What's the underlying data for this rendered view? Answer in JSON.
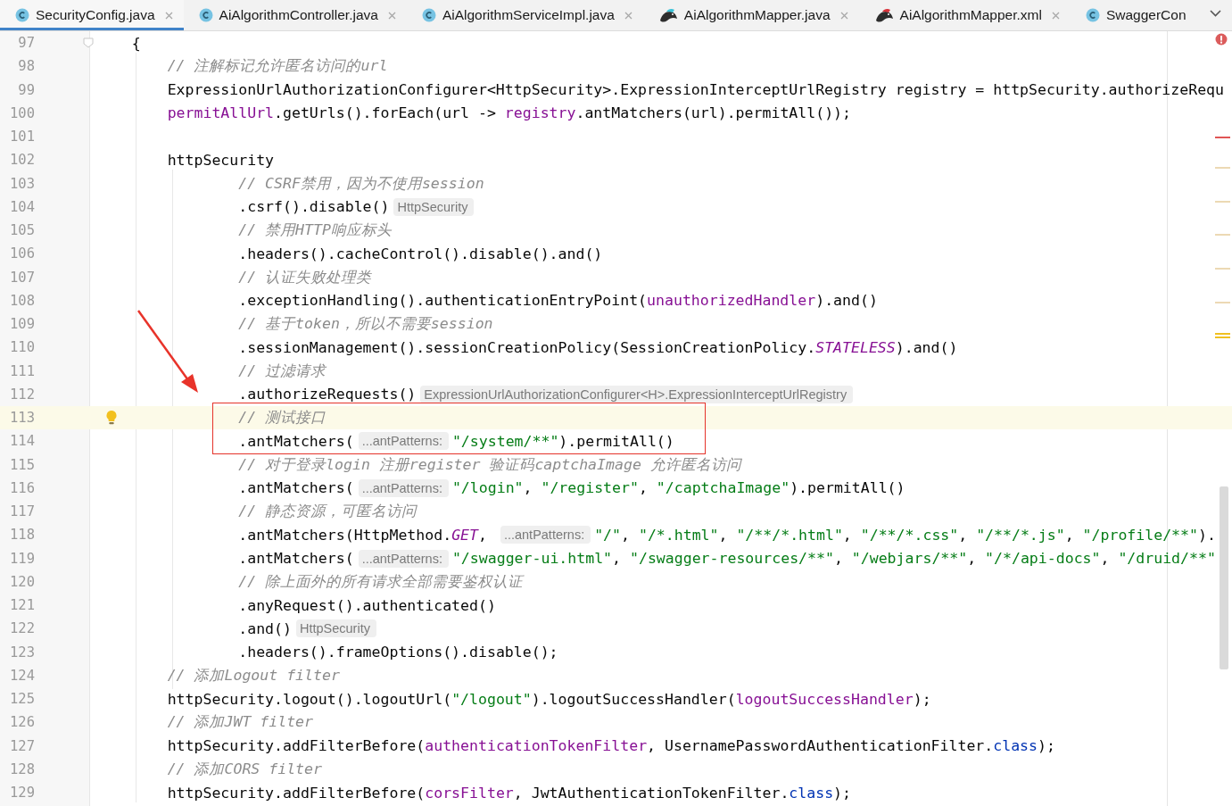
{
  "tabs": [
    {
      "label": "SecurityConfig.java",
      "kind": "class",
      "selected": true,
      "closable": true
    },
    {
      "label": "AiAlgorithmController.java",
      "kind": "class",
      "selected": false,
      "closable": true
    },
    {
      "label": "AiAlgorithmServiceImpl.java",
      "kind": "class",
      "selected": false,
      "closable": true
    },
    {
      "label": "AiAlgorithmMapper.java",
      "kind": "mapper-java",
      "selected": false,
      "closable": true
    },
    {
      "label": "AiAlgorithmMapper.xml",
      "kind": "mapper-xml",
      "selected": false,
      "closable": true
    },
    {
      "label": "SwaggerCon",
      "kind": "class",
      "selected": false,
      "closable": false
    }
  ],
  "editor": {
    "lines": [
      {
        "number": "97",
        "current": false,
        "tokens": [
          {
            "kind": "plain",
            "text": "    {"
          }
        ]
      },
      {
        "number": "98",
        "current": false,
        "tokens": [
          {
            "kind": "comment",
            "text": "        // 注解标记允许匿名访问的url"
          }
        ]
      },
      {
        "number": "99",
        "current": false,
        "tokens": [
          {
            "kind": "plain",
            "text": "        ExpressionUrlAuthorizationConfigurer<HttpSecurity>.ExpressionInterceptUrlRegistry registry = httpSecurity.authorizeRequ"
          }
        ]
      },
      {
        "number": "100",
        "current": false,
        "tokens": [
          {
            "kind": "field",
            "text": "        permitAllUrl"
          },
          {
            "kind": "plain",
            "text": ".getUrls().forEach(url -> "
          },
          {
            "kind": "field",
            "text": "registry"
          },
          {
            "kind": "plain",
            "text": ".antMatchers(url).permitAll());"
          }
        ]
      },
      {
        "number": "101",
        "current": false
      },
      {
        "number": "102",
        "current": false,
        "tokens": [
          {
            "kind": "plain",
            "text": "        httpSecurity"
          }
        ]
      },
      {
        "number": "103",
        "current": false,
        "tokens": [
          {
            "kind": "comment",
            "text": "                // CSRF禁用，因为不使用session"
          }
        ]
      },
      {
        "number": "104",
        "current": false,
        "tokens": [
          {
            "kind": "plain",
            "text": "                .csrf().disable()"
          },
          {
            "kind": "hint",
            "text": "HttpSecurity"
          }
        ]
      },
      {
        "number": "105",
        "current": false,
        "tokens": [
          {
            "kind": "comment",
            "text": "                // 禁用HTTP响应标头"
          }
        ]
      },
      {
        "number": "106",
        "current": false,
        "tokens": [
          {
            "kind": "plain",
            "text": "                .headers().cacheControl().disable().and()"
          }
        ]
      },
      {
        "number": "107",
        "current": false,
        "tokens": [
          {
            "kind": "comment",
            "text": "                // 认证失败处理类"
          }
        ]
      },
      {
        "number": "108",
        "current": false,
        "tokens": [
          {
            "kind": "plain",
            "text": "                .exceptionHandling().authenticationEntryPoint("
          },
          {
            "kind": "field",
            "text": "unauthorizedHandler"
          },
          {
            "kind": "plain",
            "text": ").and()"
          }
        ]
      },
      {
        "number": "109",
        "current": false,
        "tokens": [
          {
            "kind": "comment",
            "text": "                // 基于token，所以不需要session"
          }
        ]
      },
      {
        "number": "110",
        "current": false,
        "tokens": [
          {
            "kind": "plain",
            "text": "                .sessionManagement().sessionCreationPolicy(SessionCreationPolicy."
          },
          {
            "kind": "static",
            "text": "STATELESS"
          },
          {
            "kind": "plain",
            "text": ").and()"
          }
        ]
      },
      {
        "number": "111",
        "current": false,
        "tokens": [
          {
            "kind": "comment",
            "text": "                // 过滤请求"
          }
        ]
      },
      {
        "number": "112",
        "current": false,
        "tokens": [
          {
            "kind": "plain",
            "text": "                .authorizeRequests()"
          },
          {
            "kind": "hint",
            "text": "ExpressionUrlAuthorizationConfigurer<H>.ExpressionInterceptUrlRegistry"
          }
        ]
      },
      {
        "number": "113",
        "current": true,
        "tokens": [
          {
            "kind": "comment",
            "text": "                // 测试接口"
          }
        ]
      },
      {
        "number": "114",
        "current": false,
        "tokens": [
          {
            "kind": "plain",
            "text": "                .antMatchers("
          },
          {
            "kind": "hint",
            "text": "...antPatterns:"
          },
          {
            "kind": "string",
            "text": "\"/system/**\""
          },
          {
            "kind": "plain",
            "text": ").permitAll()"
          }
        ]
      },
      {
        "number": "115",
        "current": false,
        "tokens": [
          {
            "kind": "comment",
            "text": "                // 对于登录login 注册register 验证码captchaImage 允许匿名访问"
          }
        ]
      },
      {
        "number": "116",
        "current": false,
        "tokens": [
          {
            "kind": "plain",
            "text": "                .antMatchers("
          },
          {
            "kind": "hint",
            "text": "...antPatterns:"
          },
          {
            "kind": "string",
            "text": "\"/login\""
          },
          {
            "kind": "plain",
            "text": ", "
          },
          {
            "kind": "string",
            "text": "\"/register\""
          },
          {
            "kind": "plain",
            "text": ", "
          },
          {
            "kind": "string",
            "text": "\"/captchaImage\""
          },
          {
            "kind": "plain",
            "text": ").permitAll()"
          }
        ]
      },
      {
        "number": "117",
        "current": false,
        "tokens": [
          {
            "kind": "comment",
            "text": "                // 静态资源，可匿名访问"
          }
        ]
      },
      {
        "number": "118",
        "current": false,
        "tokens": [
          {
            "kind": "plain",
            "text": "                .antMatchers(HttpMethod."
          },
          {
            "kind": "static",
            "text": "GET"
          },
          {
            "kind": "plain",
            "text": ", "
          },
          {
            "kind": "hint",
            "text": "...antPatterns:"
          },
          {
            "kind": "string",
            "text": "\"/\""
          },
          {
            "kind": "plain",
            "text": ", "
          },
          {
            "kind": "string",
            "text": "\"/*.html\""
          },
          {
            "kind": "plain",
            "text": ", "
          },
          {
            "kind": "string",
            "text": "\"/**/*.html\""
          },
          {
            "kind": "plain",
            "text": ", "
          },
          {
            "kind": "string",
            "text": "\"/**/*.css\""
          },
          {
            "kind": "plain",
            "text": ", "
          },
          {
            "kind": "string",
            "text": "\"/**/*.js\""
          },
          {
            "kind": "plain",
            "text": ", "
          },
          {
            "kind": "string",
            "text": "\"/profile/**\""
          },
          {
            "kind": "plain",
            "text": ")."
          }
        ]
      },
      {
        "number": "119",
        "current": false,
        "tokens": [
          {
            "kind": "plain",
            "text": "                .antMatchers("
          },
          {
            "kind": "hint",
            "text": "...antPatterns:"
          },
          {
            "kind": "string",
            "text": "\"/swagger-ui.html\""
          },
          {
            "kind": "plain",
            "text": ", "
          },
          {
            "kind": "string",
            "text": "\"/swagger-resources/**\""
          },
          {
            "kind": "plain",
            "text": ", "
          },
          {
            "kind": "string",
            "text": "\"/webjars/**\""
          },
          {
            "kind": "plain",
            "text": ", "
          },
          {
            "kind": "string",
            "text": "\"/*/api-docs\""
          },
          {
            "kind": "plain",
            "text": ", "
          },
          {
            "kind": "string",
            "text": "\"/druid/**\""
          }
        ]
      },
      {
        "number": "120",
        "current": false,
        "tokens": [
          {
            "kind": "comment",
            "text": "                // 除上面外的所有请求全部需要鉴权认证"
          }
        ]
      },
      {
        "number": "121",
        "current": false,
        "tokens": [
          {
            "kind": "plain",
            "text": "                .anyRequest().authenticated()"
          }
        ]
      },
      {
        "number": "122",
        "current": false,
        "tokens": [
          {
            "kind": "plain",
            "text": "                .and()"
          },
          {
            "kind": "hint",
            "text": "HttpSecurity"
          }
        ]
      },
      {
        "number": "123",
        "current": false,
        "tokens": [
          {
            "kind": "plain",
            "text": "                .headers().frameOptions().disable();"
          }
        ]
      },
      {
        "number": "124",
        "current": false,
        "tokens": [
          {
            "kind": "comment",
            "text": "        // 添加Logout filter"
          }
        ]
      },
      {
        "number": "125",
        "current": false,
        "tokens": [
          {
            "kind": "plain",
            "text": "        httpSecurity.logout().logoutUrl("
          },
          {
            "kind": "string",
            "text": "\"/logout\""
          },
          {
            "kind": "plain",
            "text": ").logoutSuccessHandler("
          },
          {
            "kind": "field",
            "text": "logoutSuccessHandler"
          },
          {
            "kind": "plain",
            "text": ");"
          }
        ]
      },
      {
        "number": "126",
        "current": false,
        "tokens": [
          {
            "kind": "comment",
            "text": "        // 添加JWT filter"
          }
        ]
      },
      {
        "number": "127",
        "current": false,
        "tokens": [
          {
            "kind": "plain",
            "text": "        httpSecurity.addFilterBefore("
          },
          {
            "kind": "field",
            "text": "authenticationTokenFilter"
          },
          {
            "kind": "plain",
            "text": ", UsernamePasswordAuthenticationFilter."
          },
          {
            "kind": "keyword",
            "text": "class"
          },
          {
            "kind": "plain",
            "text": ");"
          }
        ]
      },
      {
        "number": "128",
        "current": false,
        "tokens": [
          {
            "kind": "comment",
            "text": "        // 添加CORS filter"
          }
        ]
      },
      {
        "number": "129",
        "current": false,
        "tokens": [
          {
            "kind": "plain",
            "text": "        httpSecurity.addFilterBefore("
          },
          {
            "kind": "field",
            "text": "corsFilter"
          },
          {
            "kind": "plain",
            "text": ", JwtAuthenticationTokenFilter."
          },
          {
            "kind": "keyword",
            "text": "class"
          },
          {
            "kind": "plain",
            "text": ");"
          }
        ]
      }
    ]
  }
}
